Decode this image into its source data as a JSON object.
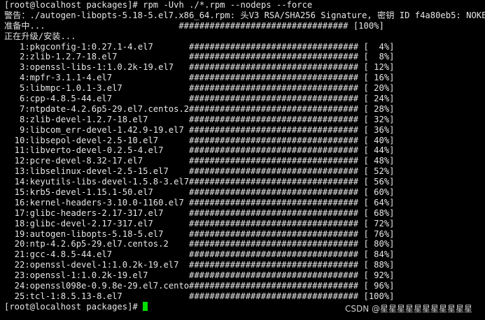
{
  "terminal": {
    "command_line": "[root@localhost packages]# rpm -Uvh ./*.rpm --nodeps --force",
    "warning_line": "警告：./autogen-libopts-5.18-5.el7.x86_64.rpm: 头V3 RSA/SHA256 Signature, 密钥 ID f4a80eb5: NOKEY",
    "preparing_line": "准备中...                          ################################# [100%]",
    "upgrading_line": "正在升级/安装...",
    "packages": [
      {
        "name": "   1:pkgconfig-1:0.27.1-4.el7",
        "progress": "[  4%]"
      },
      {
        "name": "   2:zlib-1.2.7-18.el7",
        "progress": "[  8%]"
      },
      {
        "name": "   3:openssl-libs-1:1.0.2k-19.el7",
        "progress": "[ 12%]"
      },
      {
        "name": "   4:mpfr-3.1.1-4.el7",
        "progress": "[ 16%]"
      },
      {
        "name": "   5:libmpc-1.0.1-3.el7",
        "progress": "[ 20%]"
      },
      {
        "name": "   6:cpp-4.8.5-44.el7",
        "progress": "[ 24%]"
      },
      {
        "name": "   7:ntpdate-4.2.6p5-29.el7.centos.2",
        "progress": "[ 28%]"
      },
      {
        "name": "   8:zlib-devel-1.2.7-18.el7",
        "progress": "[ 32%]"
      },
      {
        "name": "   9:libcom_err-devel-1.42.9-19.el7",
        "progress": "[ 36%]"
      },
      {
        "name": "  10:libsepol-devel-2.5-10.el7",
        "progress": "[ 40%]"
      },
      {
        "name": "  11:libverto-devel-0.2.5-4.el7",
        "progress": "[ 44%]"
      },
      {
        "name": "  12:pcre-devel-8.32-17.el7",
        "progress": "[ 48%]"
      },
      {
        "name": "  13:libselinux-devel-2.5-15.el7",
        "progress": "[ 52%]"
      },
      {
        "name": "  14:keyutils-libs-devel-1.5.8-3.el7",
        "progress": "[ 56%]"
      },
      {
        "name": "  15:krb5-devel-1.15.1-50.el7",
        "progress": "[ 60%]"
      },
      {
        "name": "  16:kernel-headers-3.10.0-1160.el7",
        "progress": "[ 64%]"
      },
      {
        "name": "  17:glibc-headers-2.17-317.el7",
        "progress": "[ 68%]"
      },
      {
        "name": "  18:glibc-devel-2.17-317.el7",
        "progress": "[ 72%]"
      },
      {
        "name": "  19:autogen-libopts-5.18-5.el7",
        "progress": "[ 76%]"
      },
      {
        "name": "  20:ntp-4.2.6p5-29.el7.centos.2",
        "progress": "[ 80%]"
      },
      {
        "name": "  21:gcc-4.8.5-44.el7",
        "progress": "[ 84%]"
      },
      {
        "name": "  22:openssl-devel-1:1.0.2k-19.el7",
        "progress": "[ 88%]"
      },
      {
        "name": "  23:openssl-1:1.0.2k-19.el7",
        "progress": "[ 92%]"
      },
      {
        "name": "  24:openssl098e-0.9.8e-29.el7.centos.",
        "progress": "[ 96%]"
      },
      {
        "name": "  25:tcl-1:8.5.13-8.el7",
        "progress": "[100%]"
      }
    ],
    "progress_bar": "#################################",
    "final_prompt": "[root@localhost packages]# ",
    "cursor_color": "#00e000"
  },
  "watermark": "CSDN @星星星星星星星星星星星"
}
